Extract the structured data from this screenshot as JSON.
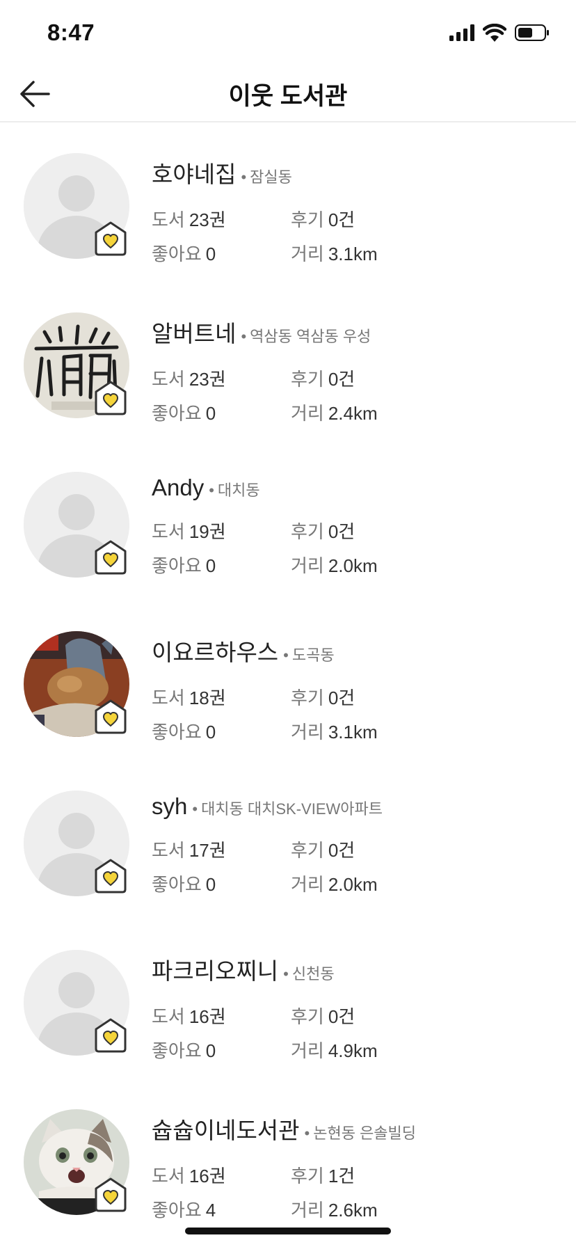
{
  "status_bar": {
    "time": "8:47"
  },
  "header": {
    "title": "이웃 도서관"
  },
  "labels": {
    "books": "도서",
    "reviews": "후기",
    "likes": "좋아요",
    "distance": "거리"
  },
  "libraries": [
    {
      "name": "호야네집",
      "location": "잠실동",
      "books": "23권",
      "reviews": "0건",
      "likes": "0",
      "distance": "3.1km",
      "avatar": "default-avatar"
    },
    {
      "name": "알버트네",
      "location": "역삼동 역삼동 우성",
      "books": "23권",
      "reviews": "0건",
      "likes": "0",
      "distance": "2.4km",
      "avatar": "calligraphy-photo"
    },
    {
      "name": "Andy",
      "location": "대치동",
      "books": "19권",
      "reviews": "0건",
      "likes": "0",
      "distance": "2.0km",
      "avatar": "default-avatar"
    },
    {
      "name": "이요르하우스",
      "location": "도곡동",
      "books": "18권",
      "reviews": "0건",
      "likes": "0",
      "distance": "3.1km",
      "avatar": "eeyore-plush-photo"
    },
    {
      "name": "syh",
      "location": "대치동 대치SK-VIEW아파트",
      "books": "17권",
      "reviews": "0건",
      "likes": "0",
      "distance": "2.0km",
      "avatar": "default-avatar"
    },
    {
      "name": "파크리오찌니",
      "location": "신천동",
      "books": "16권",
      "reviews": "0건",
      "likes": "0",
      "distance": "4.9km",
      "avatar": "default-avatar"
    },
    {
      "name": "슙슙이네도서관",
      "location": "논현동 은솔빌딩",
      "books": "16권",
      "reviews": "1건",
      "likes": "4",
      "distance": "2.6km",
      "avatar": "cat-photo"
    }
  ],
  "colors": {
    "heart": "#f5d43a",
    "avatar_bg": "#eeeeee",
    "avatar_silhouette": "#d9d9d9"
  }
}
